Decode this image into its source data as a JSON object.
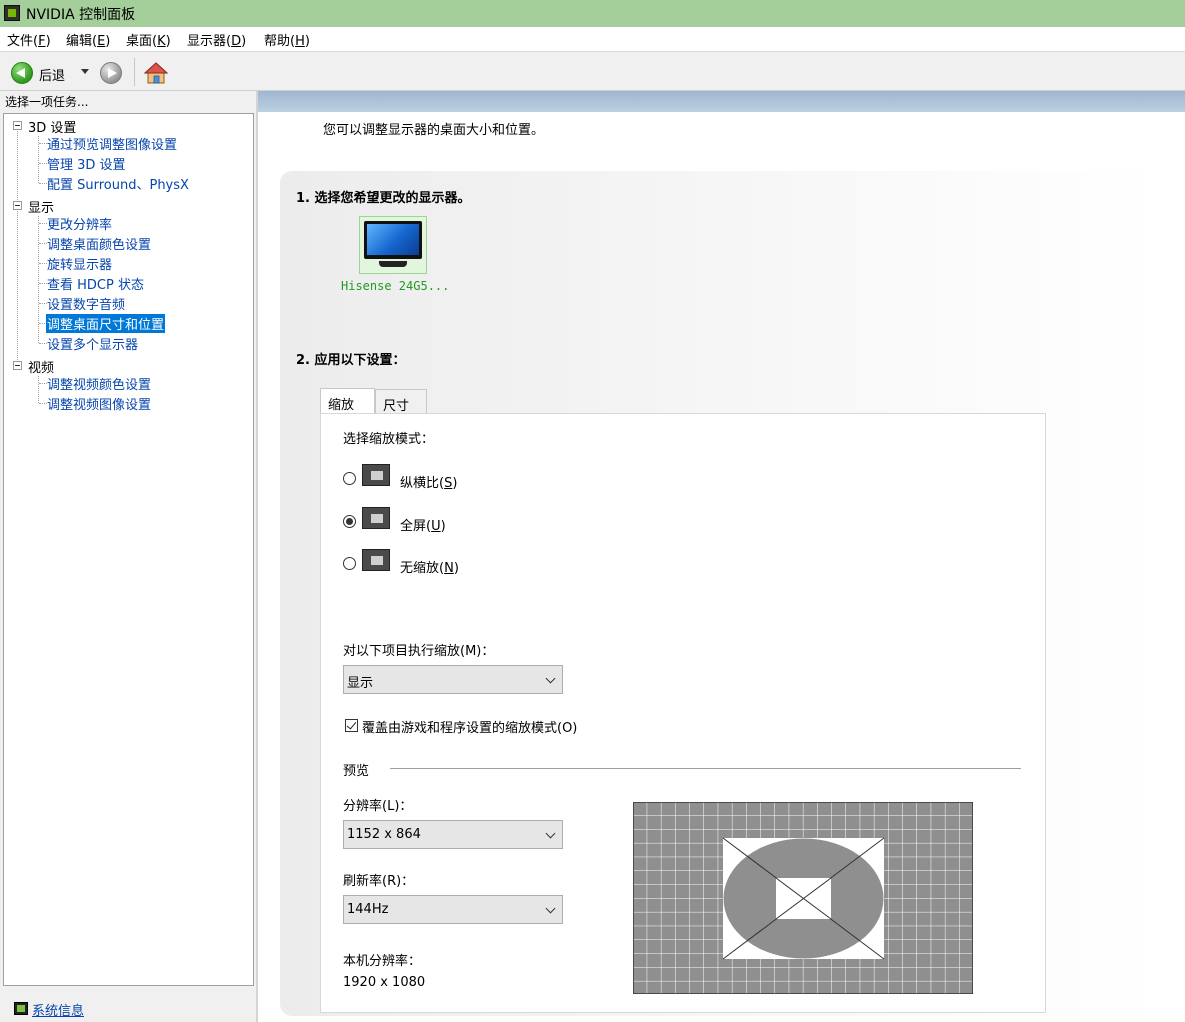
{
  "window": {
    "title": "NVIDIA 控制面板"
  },
  "menu": [
    {
      "label": "文件(",
      "key": "F",
      "end": ")"
    },
    {
      "label": "编辑(",
      "key": "E",
      "end": ")"
    },
    {
      "label": "桌面(",
      "key": "K",
      "end": ")"
    },
    {
      "label": "显示器(",
      "key": "D",
      "end": ")"
    },
    {
      "label": "帮助(",
      "key": "H",
      "end": ")"
    }
  ],
  "toolbar": {
    "back_label": "后退"
  },
  "left_panel": {
    "header": "选择一项任务...",
    "groups": [
      {
        "label": "3D 设置",
        "items": [
          "通过预览调整图像设置",
          "管理 3D 设置",
          "配置 Surround、PhysX"
        ]
      },
      {
        "label": "显示",
        "items": [
          "更改分辨率",
          "调整桌面颜色设置",
          "旋转显示器",
          "查看 HDCP 状态",
          "设置数字音频",
          "调整桌面尺寸和位置",
          "设置多个显示器"
        ]
      },
      {
        "label": "视频",
        "items": [
          "调整视频颜色设置",
          "调整视频图像设置"
        ]
      }
    ],
    "selected_item": "调整桌面尺寸和位置",
    "system_info_link": "系统信息"
  },
  "main": {
    "description": "您可以调整显示器的桌面大小和位置。",
    "step1_title": "1. 选择您希望更改的显示器。",
    "monitor_name": "Hisense 24G5...",
    "step2_title": "2. 应用以下设置：",
    "tabs": [
      "缩放",
      "尺寸"
    ],
    "active_tab": "缩放",
    "scale_mode_label": "选择缩放模式：",
    "scale_modes": [
      {
        "text": "纵横比(",
        "key": "S",
        "end": ")",
        "checked": false,
        "icon": "aspect-ratio-icon"
      },
      {
        "text": "全屏(",
        "key": "U",
        "end": ")",
        "checked": true,
        "icon": "fullscreen-icon"
      },
      {
        "text": "无缩放(",
        "key": "N",
        "end": ")",
        "checked": false,
        "icon": "no-scaling-icon"
      }
    ],
    "perform_scaling_label": "对以下项目执行缩放(M)：",
    "perform_scaling_value": "显示",
    "override_checkbox_label": "覆盖由游戏和程序设置的缩放模式(O)",
    "override_checked": true,
    "preview_label": "预览",
    "resolution_label": "分辨率(L)：",
    "resolution_value": "1152 x 864",
    "refresh_label": "刷新率(R)：",
    "refresh_value": "144Hz",
    "native_resolution_label": "本机分辨率：",
    "native_resolution_value": "1920 x 1080"
  }
}
